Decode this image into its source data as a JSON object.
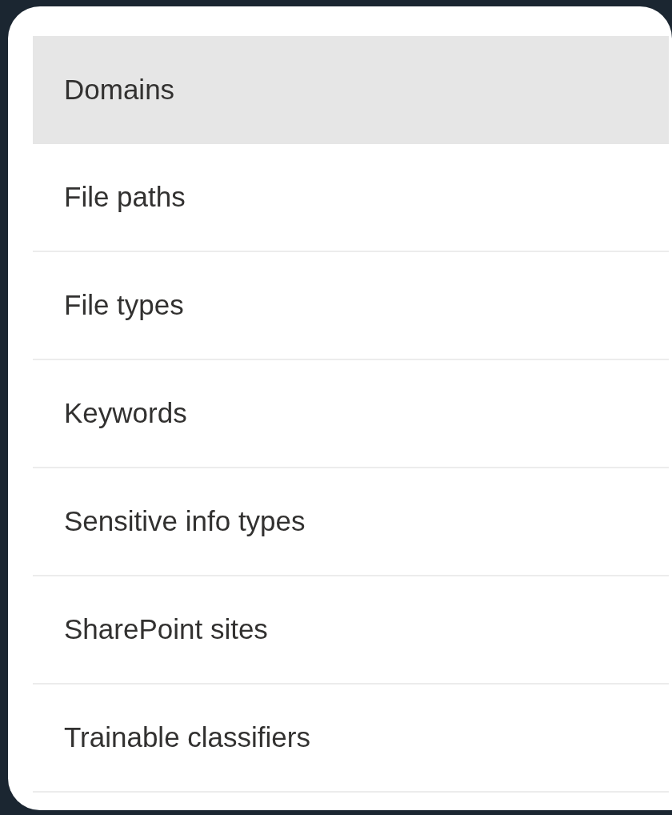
{
  "list": {
    "items": [
      {
        "label": "Domains",
        "selected": true
      },
      {
        "label": "File paths",
        "selected": false
      },
      {
        "label": "File types",
        "selected": false
      },
      {
        "label": "Keywords",
        "selected": false
      },
      {
        "label": "Sensitive info types",
        "selected": false
      },
      {
        "label": "SharePoint sites",
        "selected": false
      },
      {
        "label": "Trainable classifiers",
        "selected": false
      }
    ]
  }
}
